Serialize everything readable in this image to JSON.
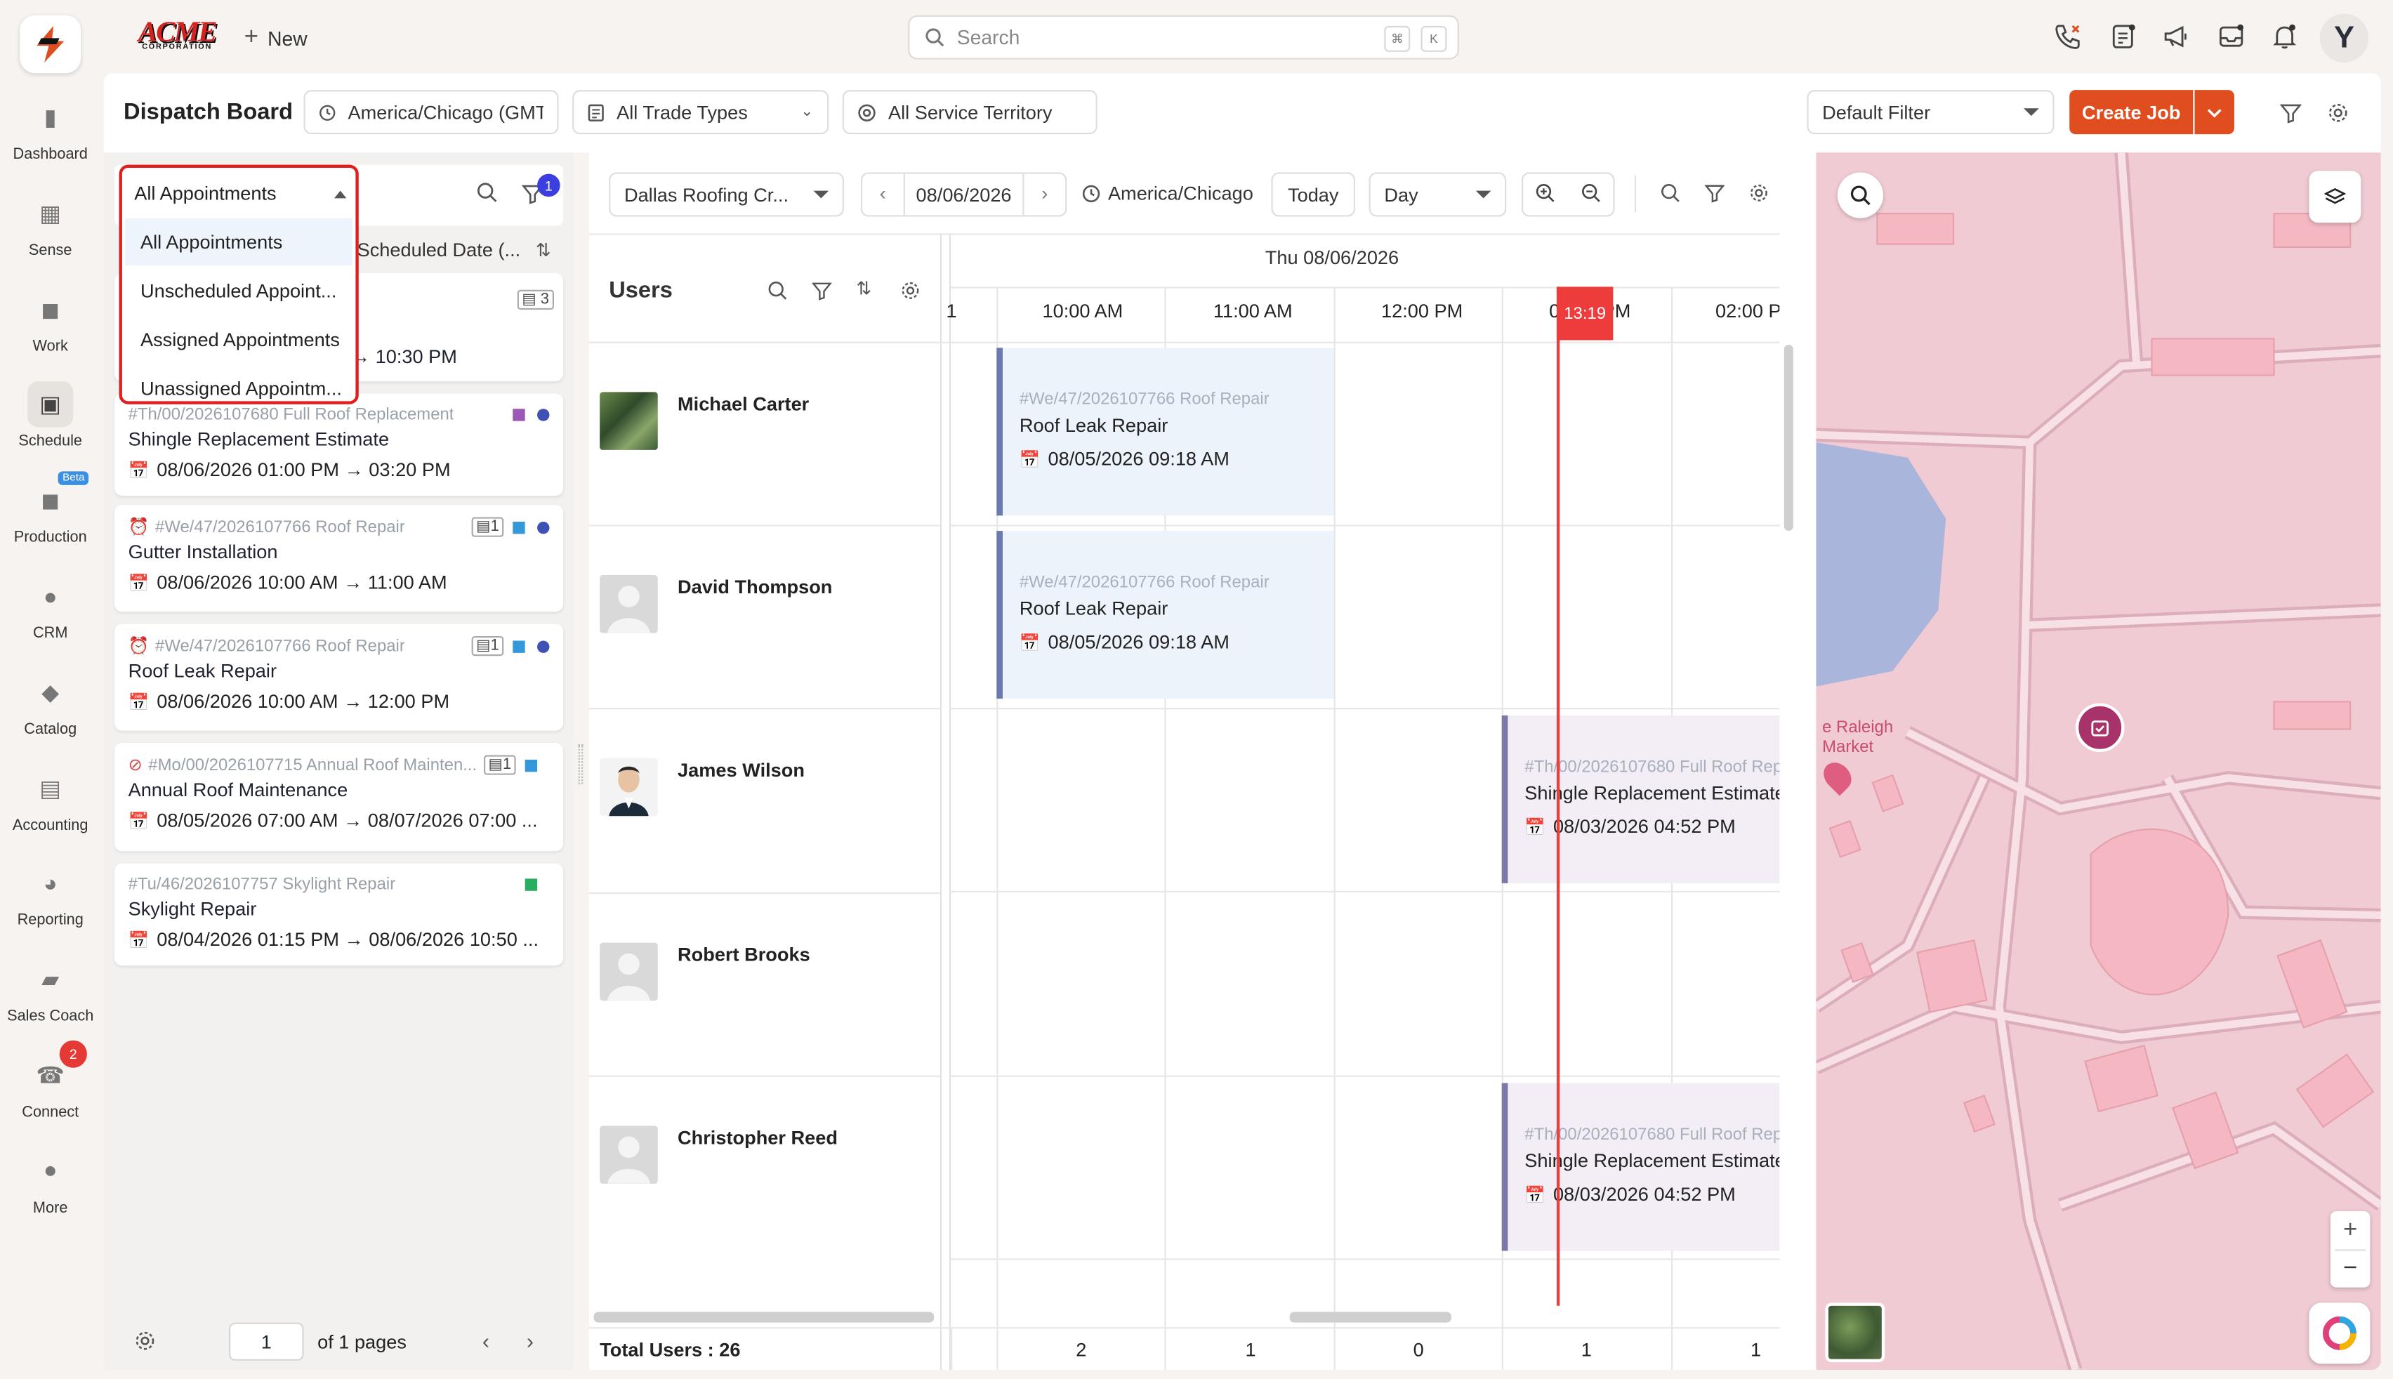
{
  "topbar": {
    "brand_line1": "ACME",
    "brand_line2": "CORPORATION",
    "new_label": "New",
    "search_placeholder": "Search",
    "kbd1": "⌘",
    "kbd2": "K",
    "avatar_initial": "Y"
  },
  "sidebar": [
    {
      "label": "Dashboard",
      "icon": "bar-chart-icon"
    },
    {
      "label": "Sense",
      "icon": "grid-icon"
    },
    {
      "label": "Work",
      "icon": "briefcase-icon"
    },
    {
      "label": "Schedule",
      "icon": "calendar-icon",
      "active": true
    },
    {
      "label": "Production",
      "icon": "truck-icon",
      "badge": "Beta"
    },
    {
      "label": "CRM",
      "icon": "users-icon"
    },
    {
      "label": "Catalog",
      "icon": "tag-icon"
    },
    {
      "label": "Accounting",
      "icon": "calculator-icon"
    },
    {
      "label": "Reporting",
      "icon": "pie-chart-icon"
    },
    {
      "label": "Sales Coach",
      "icon": "coach-icon"
    },
    {
      "label": "Connect",
      "icon": "phone-icon",
      "count": "2"
    },
    {
      "label": "More",
      "icon": "more-icon"
    }
  ],
  "header": {
    "title": "Dispatch Board",
    "timezone": "America/Chicago (GMT...",
    "trade_types": "All Trade Types",
    "territory": "All Service Territory",
    "filter": "Default Filter",
    "create_job": "Create Job"
  },
  "left": {
    "select_value": "All Appointments",
    "filter_count": "1",
    "sort_label": "Scheduled Date (...",
    "dropdown_options": [
      "All Appointments",
      "Unscheduled Appoint...",
      "Assigned Appointments",
      "Unassigned Appointm..."
    ],
    "partial_card": {
      "count": "3",
      "time": "10:30 PM"
    },
    "cards": [
      {
        "ref": "#Th/00/2026107680 Full Roof Replacement",
        "title": "Shingle Replacement Estimate",
        "date": "08/06/2026 01:00 PM → 03:20 PM",
        "sq": "#9b59b6",
        "dot": "#3f51b5"
      },
      {
        "ref": "#We/47/2026107766 Roof Repair",
        "title": "Gutter Installation",
        "date": "08/06/2026 10:00 AM → 11:00 AM",
        "count": "1",
        "sq": "#3498db",
        "dot": "#3f51b5"
      },
      {
        "ref": "#We/47/2026107766 Roof Repair",
        "title": "Roof Leak Repair",
        "date": "08/06/2026 10:00 AM → 12:00 PM",
        "count": "1",
        "sq": "#3498db",
        "dot": "#3f51b5"
      },
      {
        "ref": "#Mo/00/2026107715 Annual Roof Mainten...",
        "title": "Annual Roof Maintenance",
        "date": "08/05/2026 07:00 AM → 08/07/2026 07:00 ...",
        "count": "1",
        "sq": "#3498db"
      },
      {
        "ref": "#Tu/46/2026107757 Skylight Repair",
        "title": "Skylight Repair",
        "date": "08/04/2026 01:15 PM → 08/06/2026 10:50 ...",
        "sq": "#27ae60"
      }
    ],
    "page": "1",
    "of_pages": "of 1 pages"
  },
  "schedule": {
    "crew": "Dallas Roofing Cr...",
    "date": "08/06/2026",
    "tz": "America/Chicago",
    "today": "Today",
    "view": "Day",
    "users_title": "Users",
    "day_header": "Thu 08/06/2026",
    "hours": [
      "1",
      "10:00 AM",
      "11:00 AM",
      "12:00 PM",
      "01:00 PM",
      "02:00 P"
    ],
    "now": "13:19",
    "users": [
      "Michael Carter",
      "David Thompson",
      "James Wilson",
      "Robert Brooks",
      "Christopher Reed"
    ],
    "appointments": [
      {
        "ref": "#We/47/2026107766 Roof Repair",
        "title": "Roof Leak Repair",
        "date": "08/05/2026 09:18 AM"
      },
      {
        "ref": "#We/47/2026107766 Roof Repair",
        "title": "Roof Leak Repair",
        "date": "08/05/2026 09:18 AM"
      },
      {
        "ref": "#Th/00/2026107680 Full Roof Rep",
        "title": "Shingle Replacement Estimate",
        "date": "08/03/2026 04:52 PM"
      },
      {
        "ref": "#Th/00/2026107680 Full Roof Rep",
        "title": "Shingle Replacement Estimate",
        "date": "08/03/2026 04:52 PM"
      }
    ],
    "total_users": "Total Users : 26",
    "totals": [
      "2",
      "1",
      "0",
      "1",
      "1"
    ]
  },
  "map": {
    "place_line1": "e Raleigh",
    "place_line2": "Market"
  }
}
